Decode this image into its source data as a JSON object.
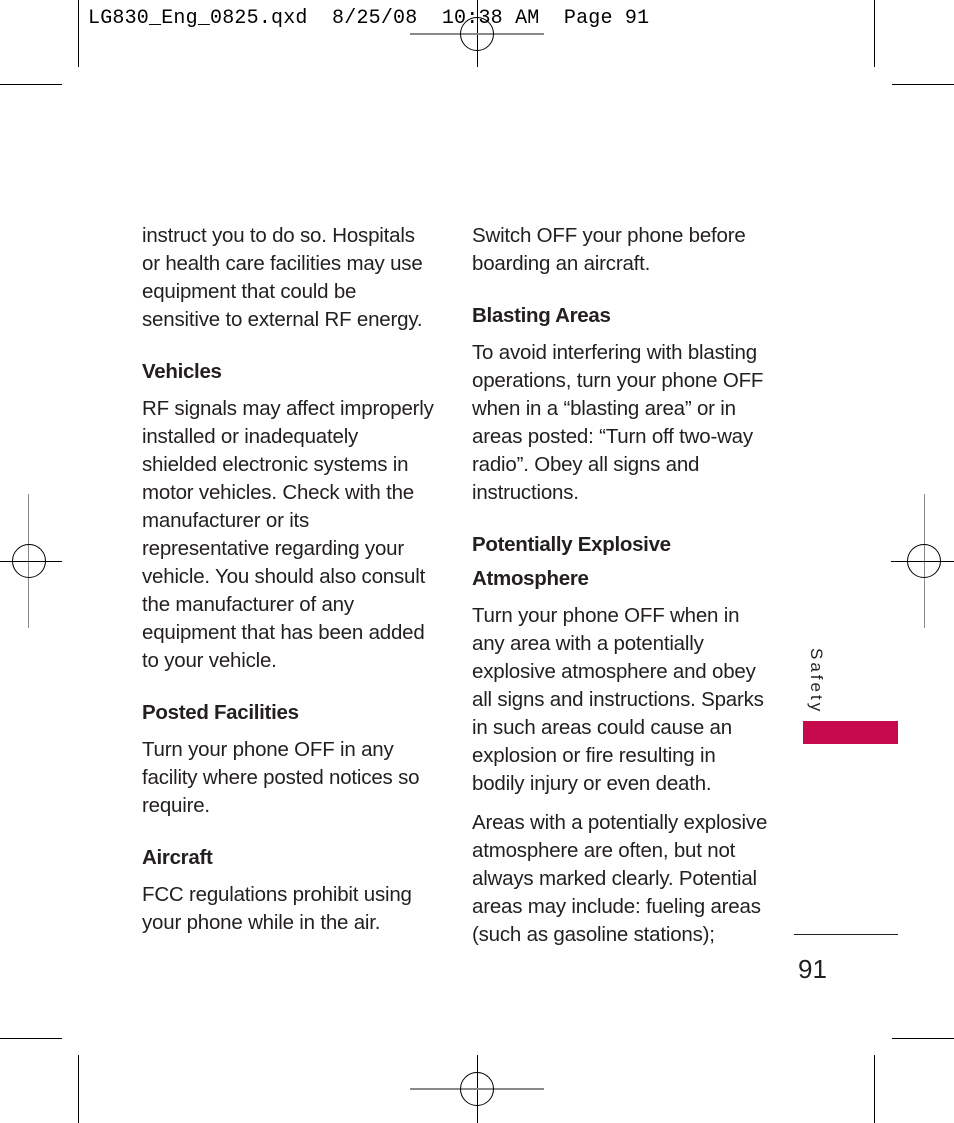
{
  "slug_line": "LG830_Eng_0825.qxd  8/25/08  10:38 AM  Page 91",
  "colors": {
    "accent": "#c70a4c",
    "text": "#231f20"
  },
  "left_column": {
    "intro_lines": [
      "instruct you to do so. Hospitals",
      "or health care facilities may use",
      "equipment that could be",
      "sensitive to external RF energy."
    ],
    "sections": [
      {
        "heading": "Vehicles",
        "lines": [
          "RF signals may affect improperly",
          "installed or inadequately",
          "shielded electronic systems in",
          "motor vehicles. Check with the",
          "manufacturer or its",
          "representative regarding your",
          "vehicle. You should also consult",
          "the manufacturer of any",
          "equipment that has been added",
          "to your vehicle."
        ]
      },
      {
        "heading": "Posted Facilities",
        "lines": [
          "Turn your phone OFF in any",
          "facility where posted notices so",
          "require."
        ]
      },
      {
        "heading": "Aircraft",
        "lines": [
          "FCC regulations prohibit using",
          "your phone while in the air."
        ]
      }
    ]
  },
  "right_column": {
    "intro_lines": [
      "Switch OFF your phone before",
      "boarding an aircraft."
    ],
    "sections": [
      {
        "heading": "Blasting Areas",
        "lines": [
          "To avoid interfering with blasting",
          "operations, turn your phone OFF",
          "when in a “blasting area” or in",
          "areas posted: “Turn off two-way",
          "radio”. Obey all signs and",
          "instructions."
        ]
      },
      {
        "heading_lines": [
          "Potentially Explosive",
          "Atmosphere"
        ],
        "paragraph1": [
          "Turn your phone OFF when in",
          "any area with a potentially",
          "explosive atmosphere and obey",
          "all signs and instructions. Sparks",
          "in such areas could cause an",
          "explosion or fire resulting in",
          "bodily injury or even death."
        ],
        "paragraph2": [
          "Areas with a potentially explosive",
          "atmosphere are often, but not",
          "always marked clearly. Potential",
          "areas may include: fueling areas",
          "(such as gasoline stations);"
        ]
      }
    ]
  },
  "side_tab": {
    "label": "Safety"
  },
  "page_number": "91"
}
